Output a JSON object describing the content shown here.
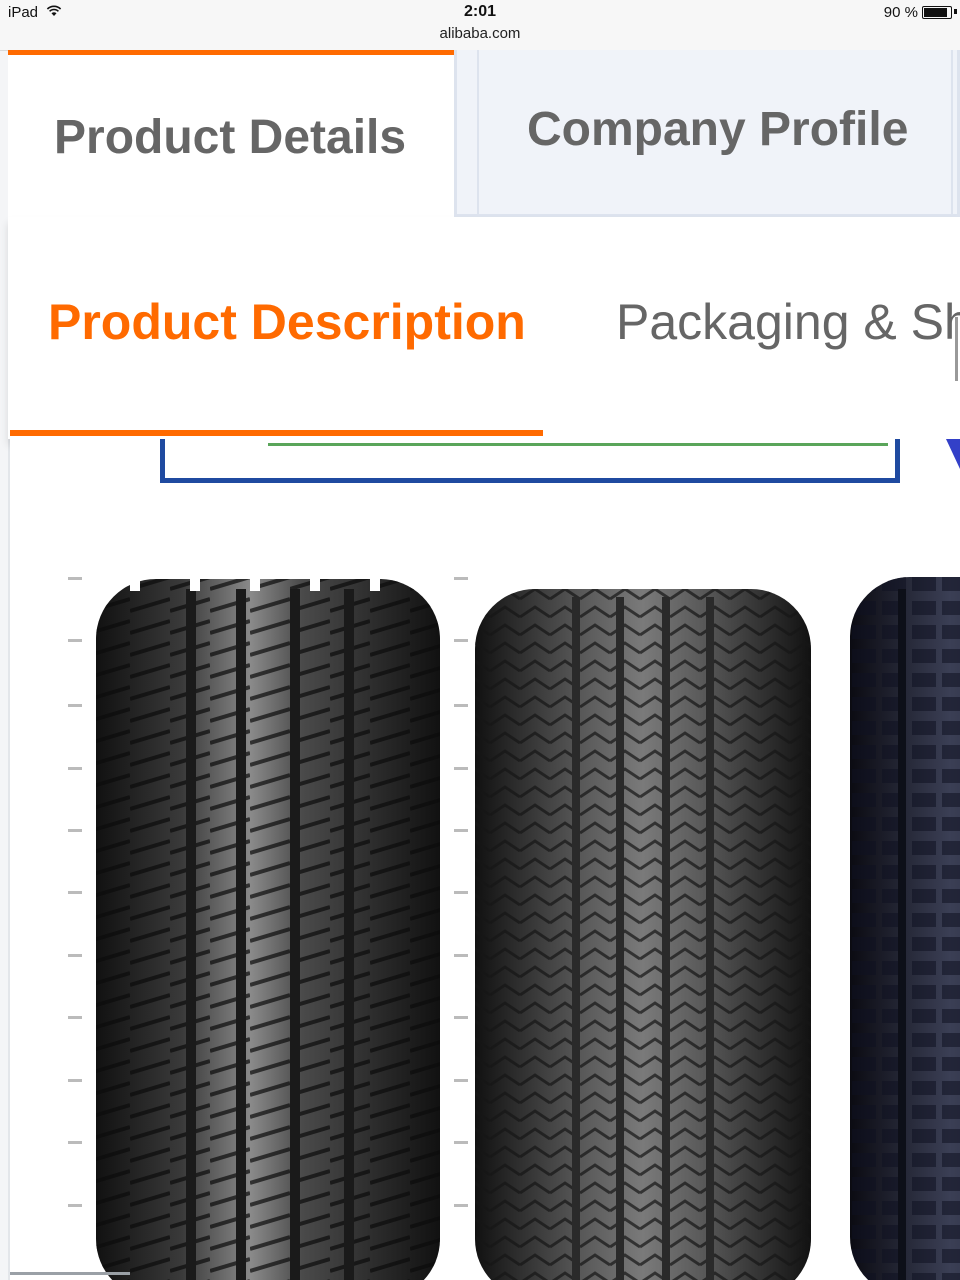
{
  "status_bar": {
    "device": "iPad",
    "time": "2:01",
    "url": "alibaba.com",
    "battery_label": "90 %",
    "battery_level": 0.9,
    "wifi_icon": "wifi-icon"
  },
  "tabs": {
    "active_label": "Product Details",
    "inactive_label": "Company Profile"
  },
  "subnav": {
    "active_label": "Product Description",
    "next_label": "Packaging & Sh"
  },
  "colors": {
    "accent": "#ff6a00",
    "tab_text": "#666666",
    "inactive_tab_bg": "#f0f3f9"
  },
  "content": {
    "image": "tire-product-photo"
  }
}
